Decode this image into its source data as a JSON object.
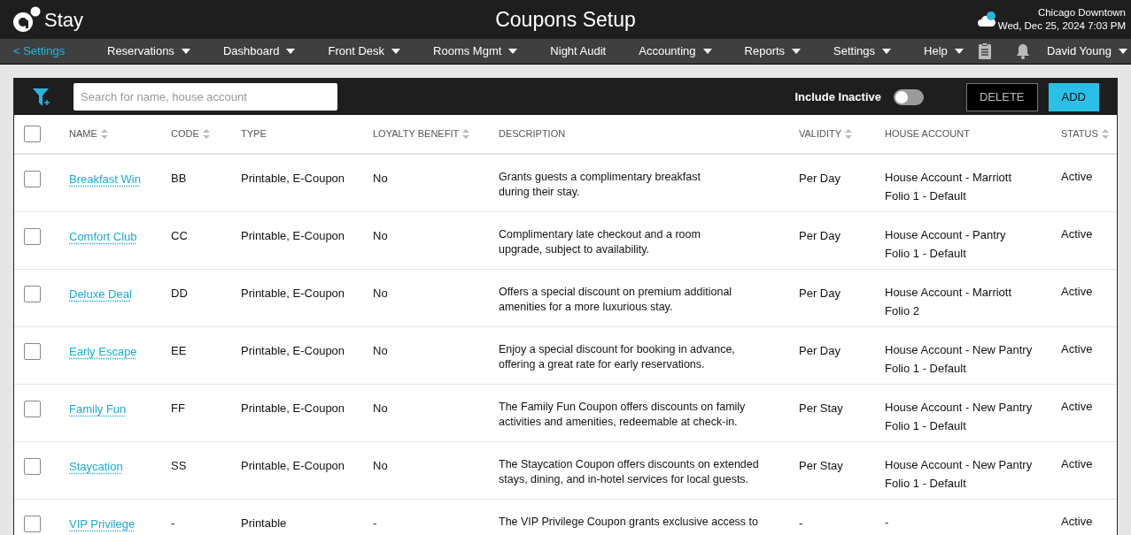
{
  "header": {
    "logo_text": "Stay",
    "title": "Coupons Setup",
    "location": "Chicago Downtown",
    "datetime": "Wed, Dec 25, 2024 7:03 PM"
  },
  "nav": {
    "back": "< Settings",
    "items": [
      {
        "label": "Reservations",
        "dropdown": true
      },
      {
        "label": "Dashboard",
        "dropdown": true
      },
      {
        "label": "Front Desk",
        "dropdown": true
      },
      {
        "label": "Rooms Mgmt",
        "dropdown": true
      },
      {
        "label": "Night Audit",
        "dropdown": false
      },
      {
        "label": "Accounting",
        "dropdown": true
      },
      {
        "label": "Reports",
        "dropdown": true
      },
      {
        "label": "Settings",
        "dropdown": true
      },
      {
        "label": "Help",
        "dropdown": true
      }
    ],
    "user": "David Young"
  },
  "toolbar": {
    "search_placeholder": "Search for name, house account",
    "include_inactive": {
      "label": "Include Inactive",
      "on": false
    },
    "buttons": [
      {
        "label": "DELETE",
        "kind": "outline"
      },
      {
        "label": "ADD",
        "kind": "primary"
      }
    ]
  },
  "table": {
    "select_all_checked": false,
    "columns": [
      {
        "label": "NAME",
        "sortable": true
      },
      {
        "label": "CODE",
        "sortable": true
      },
      {
        "label": "TYPE",
        "sortable": false
      },
      {
        "label": "LOYALTY BENEFIT",
        "sortable": true
      },
      {
        "label": "DESCRIPTION",
        "sortable": false
      },
      {
        "label": "VALIDITY",
        "sortable": true
      },
      {
        "label": "HOUSE ACCOUNT",
        "sortable": false
      },
      {
        "label": "STATUS",
        "sortable": true
      }
    ],
    "rows": [
      {
        "checked": false,
        "name": "Breakfast Win",
        "code": "BB",
        "type": "Printable, E-Coupon",
        "loyalty_benefit": "No",
        "description": [
          "Grants guests a complimentary breakfast",
          "during their stay."
        ],
        "validity": "Per Day",
        "house_account": [
          "House Account - Marriott",
          "Folio 1 - Default"
        ],
        "status": "Active"
      },
      {
        "checked": false,
        "name": "Comfort Club",
        "code": "CC",
        "type": "Printable, E-Coupon",
        "loyalty_benefit": "No",
        "description": [
          "Complimentary late checkout and a room",
          "upgrade, subject to availability."
        ],
        "validity": "Per Day",
        "house_account": [
          "House Account - Pantry",
          "Folio 1 - Default"
        ],
        "status": "Active"
      },
      {
        "checked": false,
        "name": "Deluxe Deal",
        "code": "DD",
        "type": "Printable, E-Coupon",
        "loyalty_benefit": "No",
        "description": [
          "Offers a special discount on premium additional",
          "amenities for a more luxurious stay."
        ],
        "validity": "Per Day",
        "house_account": [
          "House Account - Marriott",
          "Folio 2"
        ],
        "status": "Active"
      },
      {
        "checked": false,
        "name": "Early Escape",
        "code": "EE",
        "type": "Printable, E-Coupon",
        "loyalty_benefit": "No",
        "description": [
          "Enjoy a special discount for booking in advance,",
          "offering a great rate for early reservations."
        ],
        "validity": "Per Day",
        "house_account": [
          "House Account - New Pantry",
          "Folio 1 - Default"
        ],
        "status": "Active"
      },
      {
        "checked": false,
        "name": "Family Fun",
        "code": "FF",
        "type": "Printable, E-Coupon",
        "loyalty_benefit": "No",
        "description": [
          "The Family Fun Coupon offers discounts on family",
          "activities and amenities, redeemable at check-in."
        ],
        "validity": "Per Stay",
        "house_account": [
          "House Account - New Pantry",
          "Folio 1 - Default"
        ],
        "status": "Active"
      },
      {
        "checked": false,
        "name": "Staycation",
        "code": "SS",
        "type": "Printable, E-Coupon",
        "loyalty_benefit": "No",
        "description": [
          "The Staycation Coupon offers discounts on extended",
          "stays, dining, and in-hotel services for local guests."
        ],
        "validity": "Per Stay",
        "house_account": [
          "House Account - New Pantry",
          "Folio 1 - Default"
        ],
        "status": "Active"
      },
      {
        "checked": false,
        "name": "VIP Privilege",
        "code": "-",
        "type": "Printable",
        "loyalty_benefit": "-",
        "description": [
          "The VIP Privilege Coupon grants exclusive access to"
        ],
        "validity": "-",
        "house_account": [
          "-"
        ],
        "status": "Active"
      }
    ]
  }
}
